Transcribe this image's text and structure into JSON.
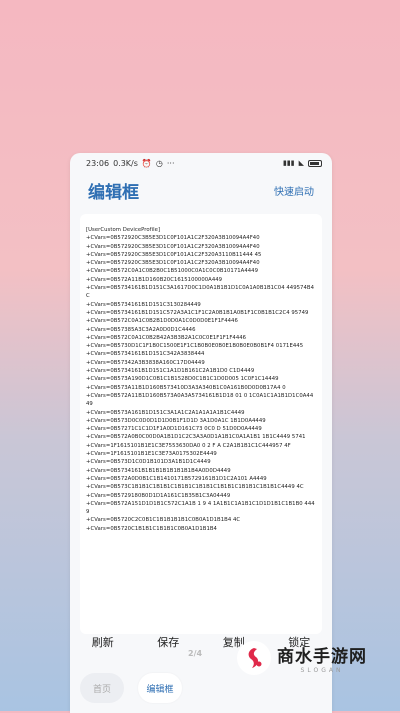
{
  "status_bar": {
    "time": "23:06",
    "speed": "0.3K/s",
    "battery": "61"
  },
  "app_bar": {
    "title": "编辑框",
    "quick_start": "快速启动"
  },
  "editor_lines": [
    "[UserCustom DeviceProfile]",
    "+CVars=0B572920C3B5E3D1C0F101A1C2F320A3B10094A4F40",
    "+CVars=0B572920C3B5E3D1C0F101A1C2F320A3B10094A4F40",
    "+CVars=0B572920C3B5E3D1C0F101A1C2F320A3110B11444   45",
    "+CVars=0B572920C3B5E3D1C0F101A1C2F320A3B10094A4F40",
    "+CVars=0B572C0A1C0B2B0C1B51000C0A1C0C0B10171A4449",
    "+CVars=0B572A11B1D160B20C1615100000A449",
    "+CVars=0B5734161B1D151C3A1617D0C1D0A1B1B1D1C0A1A0B1B1C04 449574B4C",
    "+CVars=0B5734161B1D151C3130284449",
    "+CVars=0B5734161B1D151C572A3A1C1F1C2A0B1B1A0B1F1C0B1B1C2C4 95749",
    "+CVars=0B572C0A1C0B2B1D0D0A1C0D0D0E1F1F4446",
    "+CVars=0B57385A3C3A2A0D0D1C4446",
    "+CVars=0B572C0A1C0B2B42A3B3B2A1C0C0E1F1F1F4446",
    "+CVars=0B5730D1C1F1B0C1500E1F1C1B0B0E0B0E1B0B0E0B0B1F4 0171E445",
    "+CVars=0B5734161B1D151C342A3838444",
    "+CVars=0B57342A3B3838A160C17D04449",
    "+CVars=0B5734161B1D151C1A1D1B161C2A1B1D0 C1D4449",
    "+CVars=0B573A190D1C0B1C1B1528D0C1B1C1D0D005 1C0F1C14449",
    "+CVars=0B573A11B1D160B573410D3A3A340B1C0A161B0D0D0B17A4 0",
    "+CVars=0B572A11B1D160B573A0A3A5734161B1D18 01 0 1C0A1C1A1B1D1C0A4449",
    "+CVars=0B573A161B1D151C3A1A1C2A1A1A1A1B1C4449",
    "+CVars=0B573D0C0D0D1D1D0B1F1D1D 3A1D0A1C 1B1D0A4449",
    "+CVars=0B57271C1C1D1F1A0D1D161C73 0C0 D 51D0D0A4449",
    "+CVars=0B572A0B0C00D0A1B1D1C2C3A3A0D1A1B1C0A1A1B1 1B1C4449 5741",
    "+CVars=1F1615101B1E1C3E7553630DA0 0 2 F A C2A1B1B1C1C444957 4F",
    "+CVars=1F1615101B1E1C3E73A0175302E4449",
    "+CVars=0B573D1C0D1B101D3A1B1D1C4449",
    "+CVars=0B5734161B1B1B1B1B1B1B1B4A0D0D4449",
    "+CVars=0B572A0D0B1C1B1410171B5729161B1D1C2A101 A4449",
    "+CVars=0B573C1B1B1C1B1B1C1B1B1C1B1B1C1B1B1C1B1B1C1B1B1C4449 4C",
    "+CVars=0B5729180B0D1D1A161C1B35B1C3A04449",
    "+CVars=0B572A151D1D1B1C572C1A1B 1 9 4 1A1B1C1A1B1C1D1D1B1C1B1B0 4449",
    "+CVars=0B5720C2C0B1C1B1B1B1B1C0B0A1D1B1B4 4C",
    "+CVars=0B5720C1B1B1C1B1B1C0B0A1D1B1B4"
  ],
  "actions": {
    "refresh": "刷新",
    "save": "保存",
    "copy": "复制",
    "lock": "锁定"
  },
  "page_indicator": "2/4",
  "bottom_nav": {
    "home": "首页",
    "editor": "编辑框"
  },
  "watermark": {
    "name": "商水手游网",
    "sub": "SLOGAN"
  },
  "colors": {
    "accent": "#2f6fb3",
    "watermark_logo": "#e0294a"
  }
}
